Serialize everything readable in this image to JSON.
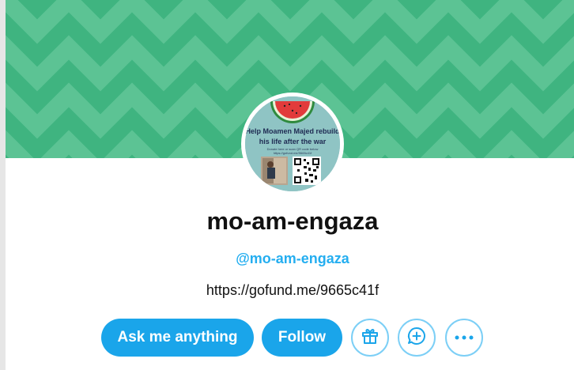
{
  "profile": {
    "display_name": "mo-am-engaza",
    "handle": "@mo-am-engaza",
    "website": "https://gofund.me/9665c41f",
    "avatar": {
      "headline": "Help Moamen Majed rebuild his life after the war",
      "small_text": "Donate here or scan QR code below https://gofund.me/9665c41f",
      "icons": [
        "watermelon-icon",
        "qr-code-icon"
      ]
    }
  },
  "actions": {
    "ask_label": "Ask me anything",
    "follow_label": "Follow",
    "icons": [
      "gift-icon",
      "ask-bubble-icon",
      "more-icon"
    ]
  },
  "colors": {
    "banner_green": "#3fb480",
    "banner_chevron": "#5cc394",
    "accent_blue": "#1aa5ea",
    "handle_blue": "#24aef0"
  }
}
